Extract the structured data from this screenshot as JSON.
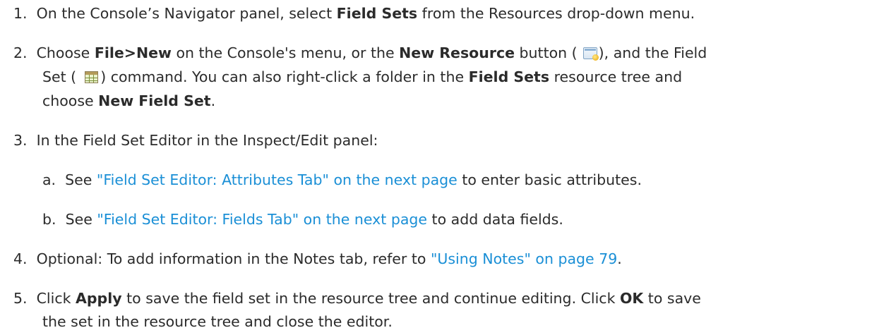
{
  "steps": [
    {
      "number": "1.",
      "text_a": "On the Console’s Navigator panel, select ",
      "bold_a": "Field Sets",
      "text_b": " from the Resources drop-down menu."
    },
    {
      "number": "2.",
      "text_a": "Choose ",
      "bold_a": "File>New",
      "text_b": " on the Console's menu, or the ",
      "bold_b": "New Resource",
      "text_c": " button (",
      "text_d": "), and the Field",
      "text_e": "Set (",
      "text_f": ") command. You can also right-click a folder in the ",
      "bold_c": "Field Sets",
      "text_g": " resource tree and",
      "text_h": "choose ",
      "bold_d": "New Field Set",
      "text_i": "."
    },
    {
      "number": "3.",
      "text_a": "In the Field Set Editor in the Inspect/Edit panel:",
      "substeps": [
        {
          "letter": "a.",
          "text_a": "See ",
          "link": "\"Field Set Editor: Attributes Tab\" on the next page",
          "text_b": " to enter basic attributes."
        },
        {
          "letter": "b.",
          "text_a": "See ",
          "link": "\"Field Set Editor: Fields Tab\" on the next page",
          "text_b": " to add data fields."
        }
      ]
    },
    {
      "number": "4.",
      "text_a": "Optional: To add information in the Notes tab, refer to ",
      "link": "\"Using Notes\" on page 79",
      "text_b": "."
    },
    {
      "number": "5.",
      "text_a": "Click ",
      "bold_a": "Apply",
      "text_b": " to save the field set in the resource tree and continue editing. Click ",
      "bold_b": "OK",
      "text_c": " to save",
      "text_d": "the set in the resource tree and close the editor."
    }
  ],
  "icons": {
    "new_resource": "new-resource-icon",
    "field_set": "field-set-icon"
  },
  "colors": {
    "text": "#2b2b2b",
    "link": "#1a8fd6"
  }
}
